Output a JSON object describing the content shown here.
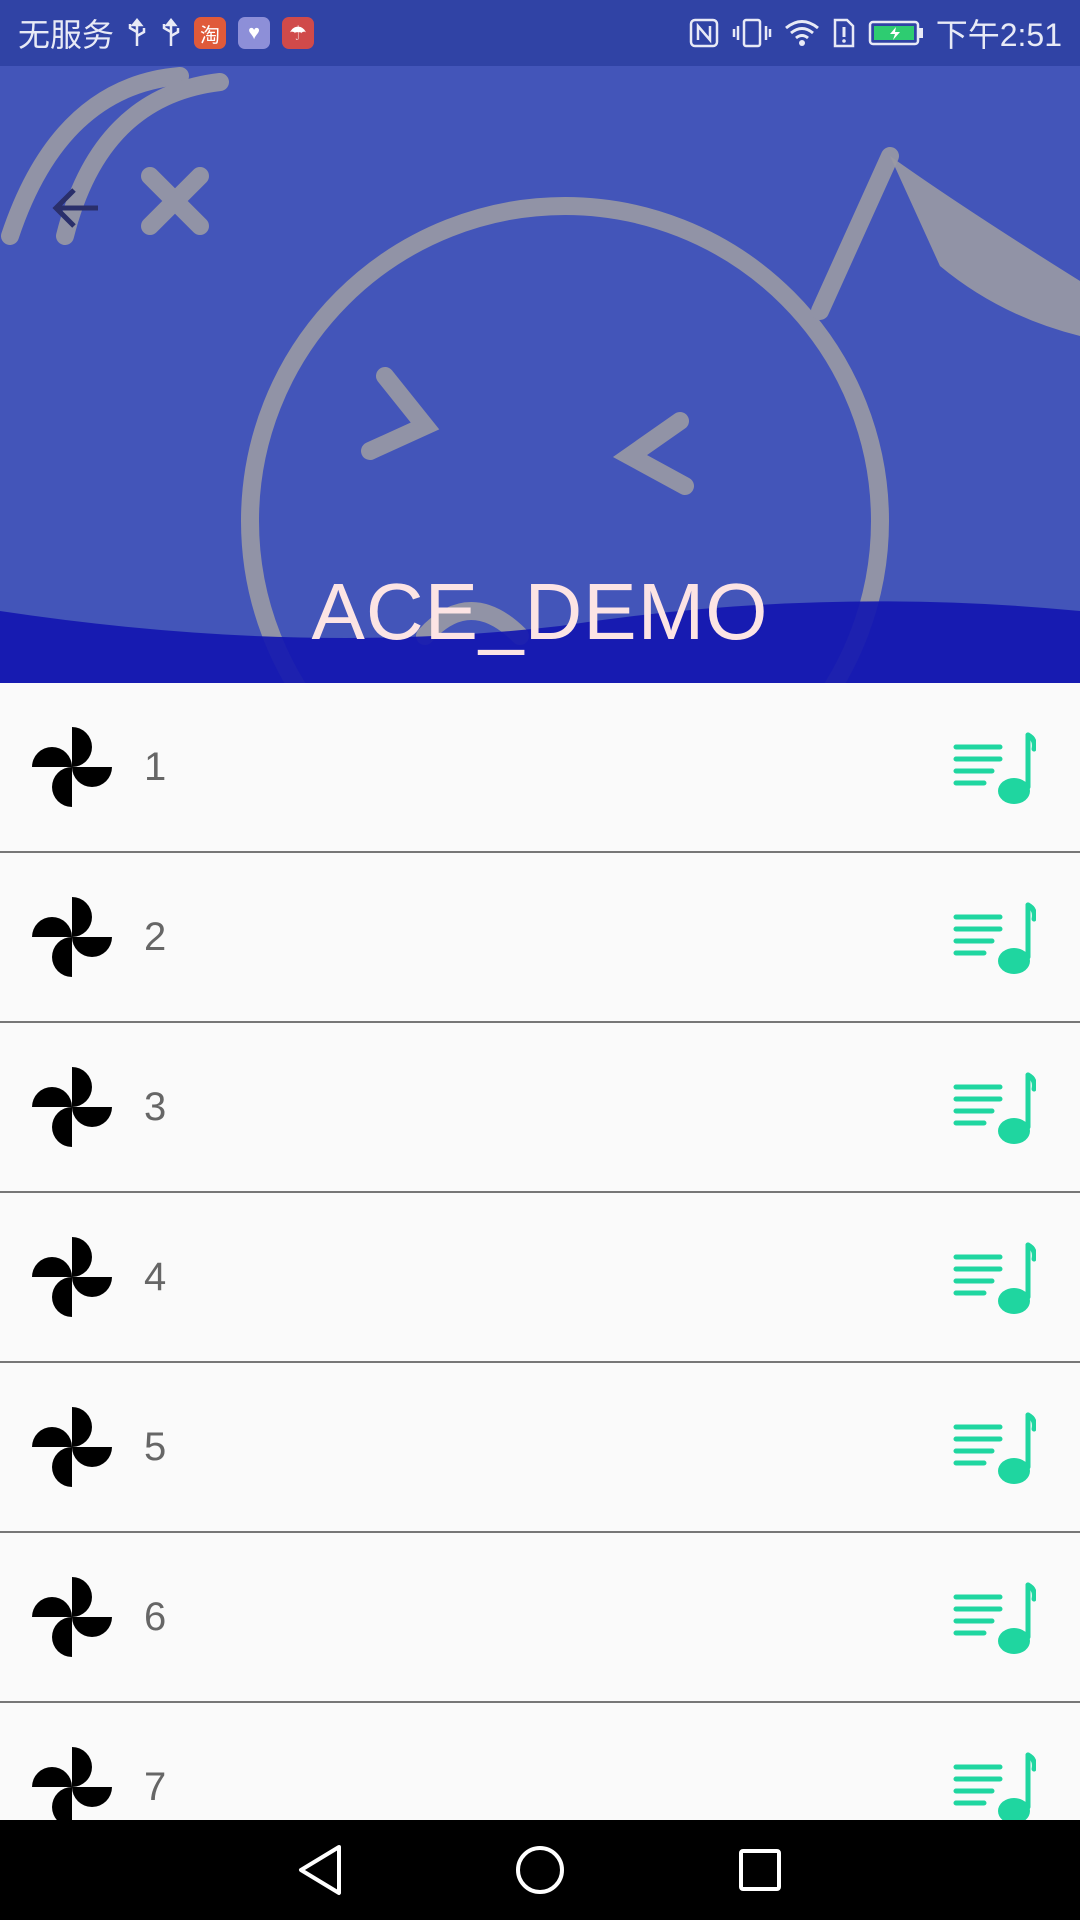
{
  "status_bar": {
    "carrier": "无服务",
    "time": "下午2:51",
    "app_badges": [
      {
        "icon": "taobao-icon",
        "label": "淘",
        "color": "#e05a3a"
      },
      {
        "icon": "heart-app-icon",
        "label": "♥",
        "color": "#8d8fd8"
      },
      {
        "icon": "umbrella-app-icon",
        "label": "☂",
        "color": "#d04a4a"
      }
    ],
    "battery_color": "#2ecc71"
  },
  "header": {
    "title": "ACE_DEMO",
    "background_color": "#4355b9",
    "wave_color": "#1417b0"
  },
  "list": {
    "accent_color": "#1fd6a0",
    "items": [
      {
        "label": "1"
      },
      {
        "label": "2"
      },
      {
        "label": "3"
      },
      {
        "label": "4"
      },
      {
        "label": "5"
      },
      {
        "label": "6"
      },
      {
        "label": "7"
      }
    ]
  }
}
